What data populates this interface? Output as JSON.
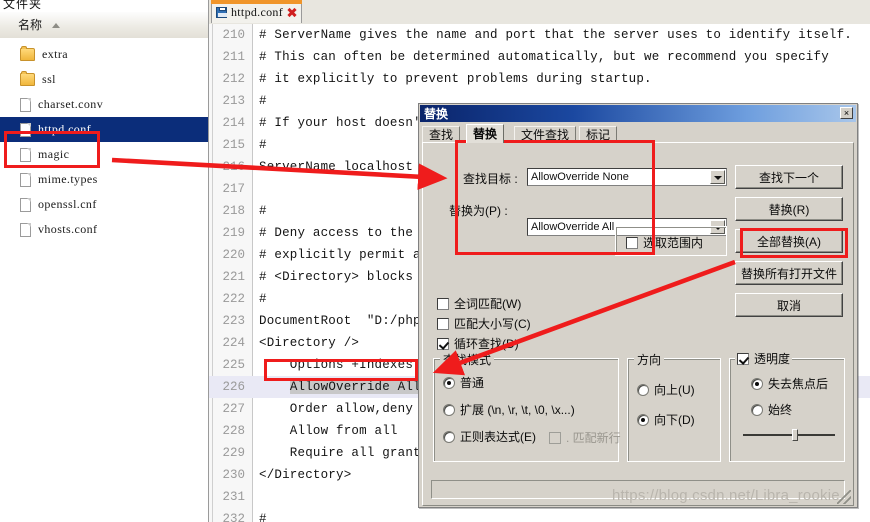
{
  "explorer": {
    "top_label": "文件夹",
    "column_header": "名称",
    "sort_indicator": "ascending",
    "files": [
      {
        "name": "extra",
        "icon": "folder-icon",
        "selected": false
      },
      {
        "name": "ssl",
        "icon": "folder-icon",
        "selected": false
      },
      {
        "name": "charset.conv",
        "icon": "file-icon",
        "selected": false
      },
      {
        "name": "httpd.conf",
        "icon": "file-icon",
        "selected": true
      },
      {
        "name": "magic",
        "icon": "file-icon",
        "selected": false
      },
      {
        "name": "mime.types",
        "icon": "file-icon",
        "selected": false
      },
      {
        "name": "openssl.cnf",
        "icon": "file-icon",
        "selected": false
      },
      {
        "name": "vhosts.conf",
        "icon": "file-icon",
        "selected": false
      }
    ]
  },
  "editor": {
    "tab": {
      "title": "httpd.conf",
      "save_icon": "save-icon",
      "close_icon": "close-icon"
    },
    "lines": [
      {
        "no": "210",
        "text": "# ServerName gives the name and port that the server uses to identify itself.",
        "highlight": false
      },
      {
        "no": "211",
        "text": "# This can often be determined automatically, but we recommend you specify",
        "highlight": false
      },
      {
        "no": "212",
        "text": "# it explicitly to prevent problems during startup.",
        "highlight": false
      },
      {
        "no": "213",
        "text": "#",
        "highlight": false
      },
      {
        "no": "214",
        "text": "# If your host doesn't have a registered DNS name, enter its IP address here.",
        "highlight": false
      },
      {
        "no": "215",
        "text": "#",
        "highlight": false
      },
      {
        "no": "216",
        "text": "ServerName localhost",
        "highlight": false
      },
      {
        "no": "217",
        "text": "",
        "highlight": false
      },
      {
        "no": "218",
        "text": "#",
        "highlight": false
      },
      {
        "no": "219",
        "text": "# Deny access to the entirety of your server's filesystem. You must",
        "highlight": false
      },
      {
        "no": "220",
        "text": "# explicitly permit access to web content directories in other",
        "highlight": false
      },
      {
        "no": "221",
        "text": "# <Directory> blocks below.",
        "highlight": false
      },
      {
        "no": "222",
        "text": "#",
        "highlight": false
      },
      {
        "no": "223",
        "text": "DocumentRoot  \"D:/phpStudy/PHPTutorial/WWW\"",
        "highlight": false
      },
      {
        "no": "224",
        "text": "<Directory />",
        "highlight": false
      },
      {
        "no": "225",
        "text": "    Options +Indexes +FollowSymLinks +ExecCGI",
        "highlight": false
      },
      {
        "no": "226",
        "text": "    AllowOverride All",
        "highlight": true
      },
      {
        "no": "227",
        "text": "    Order allow,deny",
        "highlight": false
      },
      {
        "no": "228",
        "text": "    Allow from all",
        "highlight": false
      },
      {
        "no": "229",
        "text": "    Require all granted",
        "highlight": false
      },
      {
        "no": "230",
        "text": "</Directory>",
        "highlight": false
      },
      {
        "no": "231",
        "text": "",
        "highlight": false
      },
      {
        "no": "232",
        "text": "#",
        "highlight": false
      }
    ]
  },
  "dialog": {
    "title": "替换",
    "close_label": "×",
    "tabs": [
      {
        "label": "查找",
        "active": false
      },
      {
        "label": "替换",
        "active": true
      },
      {
        "label": "文件查找",
        "active": false
      },
      {
        "label": "标记",
        "active": false
      }
    ],
    "fields": {
      "find_label": "查找目标 :",
      "find_value": "AllowOverride None",
      "replace_label": "替换为(P) :",
      "replace_value": "AllowOverride All"
    },
    "buttons": [
      {
        "label": "查找下一个",
        "highlighted": false
      },
      {
        "label": "替换(R)",
        "highlighted": false
      },
      {
        "label": "全部替换(A)",
        "highlighted": true
      },
      {
        "label": "替换所有打开文件",
        "highlighted": false
      },
      {
        "label": "取消",
        "highlighted": false
      }
    ],
    "in_selection": {
      "label": "选取范围内",
      "checked": false
    },
    "checkboxes": [
      {
        "label": "全词匹配(W)",
        "checked": false
      },
      {
        "label": "匹配大小写(C)",
        "checked": false
      },
      {
        "label": "循环查找(D)",
        "checked": true
      }
    ],
    "search_mode": {
      "caption": "查找模式",
      "options": [
        {
          "label": "普通",
          "selected": true
        },
        {
          "label": "扩展 (\\n, \\r, \\t, \\0, \\x...)",
          "selected": false
        },
        {
          "label": "正则表达式(E)",
          "selected": false
        }
      ],
      "match_newline": {
        "label": ". 匹配新行",
        "checked": false,
        "disabled": true
      }
    },
    "direction": {
      "caption": "方向",
      "options": [
        {
          "label": "向上(U)",
          "selected": false
        },
        {
          "label": "向下(D)",
          "selected": true
        }
      ]
    },
    "transparency": {
      "caption": "透明度",
      "checked": true,
      "options": [
        {
          "label": "失去焦点后",
          "selected": true
        },
        {
          "label": "始终",
          "selected": false
        }
      ],
      "slider_value": 62
    }
  },
  "annotations": {
    "color": "#ef1c1c",
    "watermark": "https://blog.csdn.net/Libra_rookie"
  }
}
